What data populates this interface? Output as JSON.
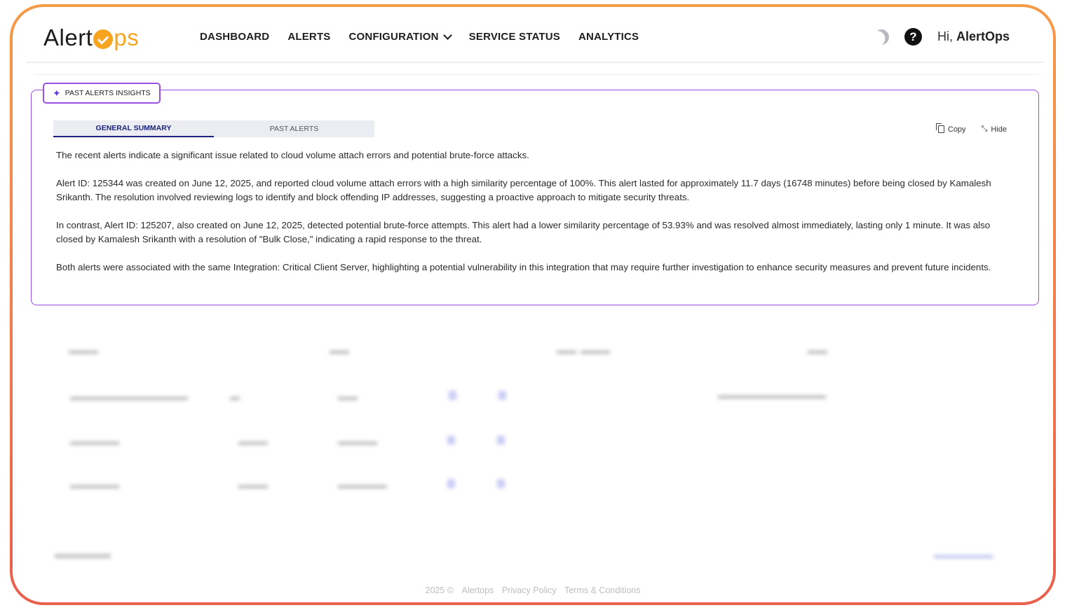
{
  "brand": {
    "name_left": "Alert",
    "name_right": "ps"
  },
  "nav": {
    "items": [
      {
        "label": "DASHBOARD"
      },
      {
        "label": "ALERTS"
      },
      {
        "label": "CONFIGURATION"
      },
      {
        "label": "SERVICE STATUS"
      },
      {
        "label": "ANALYTICS"
      }
    ]
  },
  "header": {
    "greeting_prefix": "Hi, ",
    "user_name": "AlertOps",
    "help_glyph": "?"
  },
  "panel": {
    "badge_label": "PAST ALERTS INSIGHTS",
    "tabs": [
      {
        "label": "GENERAL SUMMARY"
      },
      {
        "label": "PAST ALERTS"
      }
    ],
    "copy_label": "Copy",
    "hide_label": "Hide",
    "paragraphs": [
      "The recent alerts indicate a significant issue related to cloud volume attach errors and potential brute-force attacks.",
      "Alert ID: 125344 was created on June 12, 2025, and reported cloud volume attach errors with a high similarity percentage of 100%. This alert lasted for approximately 11.7 days (16748 minutes) before being closed by Kamalesh Srikanth. The resolution involved reviewing logs to identify and block offending IP addresses, suggesting a proactive approach to mitigate security threats.",
      "In contrast, Alert ID: 125207, also created on June 12, 2025, detected potential brute-force attempts. This alert had a lower similarity percentage of 53.93% and was resolved almost immediately, lasting only 1 minute. It was also closed by Kamalesh Srikanth with a resolution of \"Bulk Close,\" indicating a rapid response to the threat.",
      "Both alerts were associated with the same Integration: Critical Client Server, highlighting a potential vulnerability in this integration that may require further investigation to enhance security measures and prevent future incidents."
    ]
  },
  "footer": {
    "year": "2025 ©",
    "company": "Alertops",
    "privacy": "Privacy Policy",
    "terms": "Terms & Conditions"
  },
  "colors": {
    "accent_purple": "#9b4fe0",
    "brand_orange": "#f7a521",
    "tab_active": "#1b237a"
  }
}
